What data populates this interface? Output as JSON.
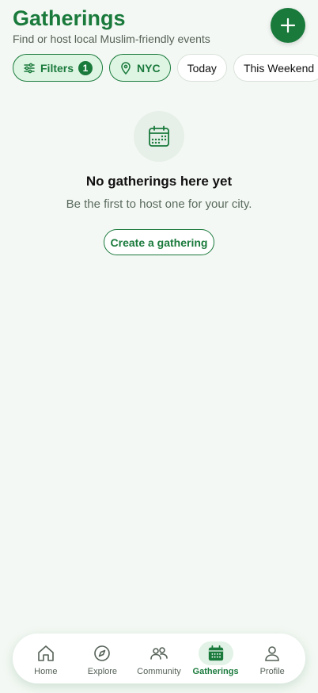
{
  "header": {
    "title": "Gatherings",
    "subtitle": "Find or host local Muslim-friendly events",
    "add_icon": "plus-icon"
  },
  "filters": {
    "filters_label": "Filters",
    "filters_count": "1",
    "location_label": "NYC",
    "today_label": "Today",
    "weekend_label": "This Weekend"
  },
  "empty_state": {
    "icon": "calendar-icon",
    "title": "No gatherings here yet",
    "subtitle": "Be the first to host one for your city.",
    "button_label": "Create a gathering"
  },
  "nav": {
    "home": "Home",
    "explore": "Explore",
    "community": "Community",
    "gatherings": "Gatherings",
    "profile": "Profile",
    "active": "Gatherings"
  },
  "colors": {
    "brand": "#1a7a3c",
    "background": "#f4f8f4",
    "chip_active_bg": "#dff5e3"
  }
}
